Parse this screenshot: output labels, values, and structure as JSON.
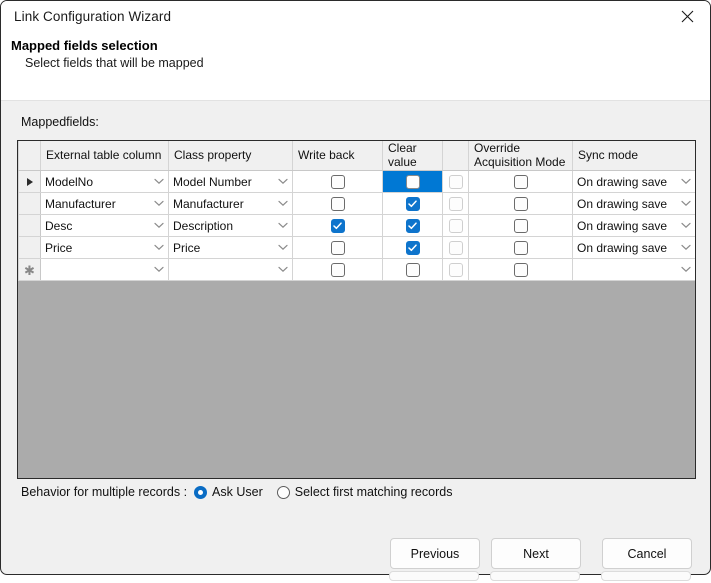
{
  "window": {
    "title": "Link Configuration Wizard",
    "close_icon": "close-icon"
  },
  "header": {
    "title": "Mapped fields selection",
    "subtitle": "Select fields that will be mapped"
  },
  "grid": {
    "label": "Mappedfields:",
    "columns": [
      {
        "key": "rowhdr",
        "label": ""
      },
      {
        "key": "external",
        "label": "External table column"
      },
      {
        "key": "classprop",
        "label": "Class property"
      },
      {
        "key": "writeback",
        "label": "Write back"
      },
      {
        "key": "clearvalue",
        "label": "Clear value"
      },
      {
        "key": "blank",
        "label": ""
      },
      {
        "key": "override",
        "label": "Override Acquisition Mode"
      },
      {
        "key": "syncmode",
        "label": "Sync mode"
      }
    ],
    "rows": [
      {
        "marker": "current-row-arrow",
        "external": "ModelNo",
        "classprop": "Model Number",
        "writeback": false,
        "clearvalue": false,
        "clearvalue_selected": true,
        "blank": false,
        "override": false,
        "syncmode": "On drawing save"
      },
      {
        "marker": "",
        "external": "Manufacturer",
        "classprop": "Manufacturer",
        "writeback": false,
        "clearvalue": true,
        "clearvalue_selected": false,
        "blank": false,
        "override": false,
        "syncmode": "On drawing save"
      },
      {
        "marker": "",
        "external": "Desc",
        "classprop": "Description",
        "writeback": true,
        "clearvalue": true,
        "clearvalue_selected": false,
        "blank": false,
        "override": false,
        "syncmode": "On drawing save"
      },
      {
        "marker": "",
        "external": "Price",
        "classprop": "Price",
        "writeback": false,
        "clearvalue": true,
        "clearvalue_selected": false,
        "blank": false,
        "override": false,
        "syncmode": "On drawing save"
      },
      {
        "marker": "new-row-asterisk",
        "external": "",
        "classprop": "",
        "writeback": false,
        "clearvalue": false,
        "clearvalue_selected": false,
        "blank": false,
        "override": false,
        "syncmode": ""
      }
    ]
  },
  "behavior": {
    "label": "Behavior for multiple records :",
    "options": [
      {
        "label": "Ask User",
        "selected": true
      },
      {
        "label": "Select first matching records",
        "selected": false
      }
    ]
  },
  "buttons": {
    "previous": "Previous",
    "next": "Next",
    "cancel": "Cancel"
  },
  "colors": {
    "accent": "#0078d4",
    "checkbox_checked": "#0e74cc",
    "grid_empty": "#ababab",
    "dialog_bg": "#f0f0f0"
  }
}
